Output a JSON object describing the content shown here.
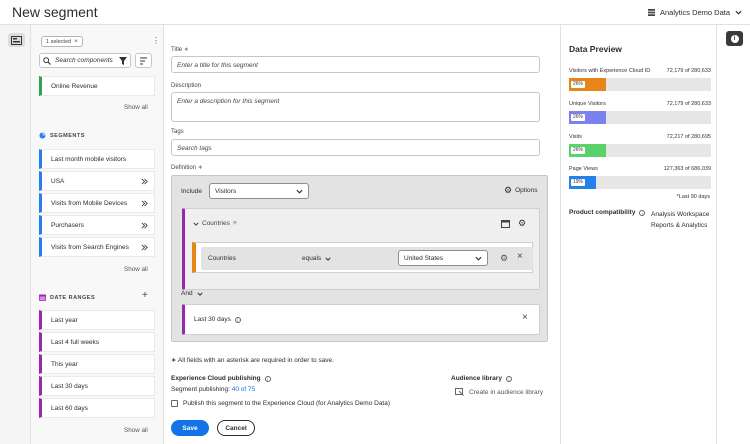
{
  "app": {
    "title": "New segment",
    "report_suite": "Analytics Demo Data"
  },
  "left_panel": {
    "selected_chip": "1 selected",
    "search_placeholder": "Search components",
    "top_items": [
      {
        "label": "Online Revenue"
      }
    ],
    "show_all": "Show all",
    "segments_header": "SEGMENTS",
    "segments": [
      {
        "label": "Last month mobile visitors"
      },
      {
        "label": "USA"
      },
      {
        "label": "Visits from Mobile Devices"
      },
      {
        "label": "Purchasers"
      },
      {
        "label": "Visits from Search Engines"
      }
    ],
    "date_ranges_header": "DATE RANGES",
    "date_ranges": [
      {
        "label": "Last year"
      },
      {
        "label": "Last 4 full weeks"
      },
      {
        "label": "This year"
      },
      {
        "label": "Last 30 days"
      },
      {
        "label": "Last 60 days"
      }
    ]
  },
  "form": {
    "title_label": "Title",
    "title_placeholder": "Enter a title for this segment",
    "description_label": "Description",
    "description_placeholder": "Enter a description for this segment",
    "tags_label": "Tags",
    "tags_placeholder": "Search tags",
    "definition_label": "Definition",
    "include_label": "Include",
    "include_value": "Visitors",
    "options_label": "Options",
    "container_label": "Countries",
    "condition": {
      "dimension": "Countries",
      "operator": "equals",
      "value": "United States"
    },
    "and_label": "And",
    "date_range_label": "Last 30 days",
    "required_note": "All fields with an asterisk are required in order to save.",
    "ec_publishing_label": "Experience Cloud publishing",
    "segment_publishing_prefix": "Segment publishing:",
    "segment_publishing_count": "40 of 75",
    "publish_checkbox_label": "Publish this segment to the Experience Cloud (for Analytics Demo Data)",
    "audience_library_label": "Audience library",
    "create_audience_label": "Create in audience library",
    "save_label": "Save",
    "cancel_label": "Cancel"
  },
  "data_preview": {
    "title": "Data Preview",
    "metrics": [
      {
        "label": "Visitors with Experience Cloud ID",
        "value": "72,179 of 280,633",
        "percent": "26%",
        "fraction": 0.26,
        "color": "#e68619"
      },
      {
        "label": "Unique Visitors",
        "value": "72,179 of 280,633",
        "percent": "26%",
        "fraction": 0.26,
        "color": "#7b82f0"
      },
      {
        "label": "Visits",
        "value": "72,217 of 280,695",
        "percent": "26%",
        "fraction": 0.26,
        "color": "#59d26a"
      },
      {
        "label": "Page Views",
        "value": "127,363 of 686,039",
        "percent": "19%",
        "fraction": 0.19,
        "color": "#2680eb"
      }
    ],
    "footnote": "*Last 90 days",
    "compat_label": "Product compatibility",
    "compat_value_1": "Analysis Workspace",
    "compat_value_2": "Reports & Analytics"
  }
}
